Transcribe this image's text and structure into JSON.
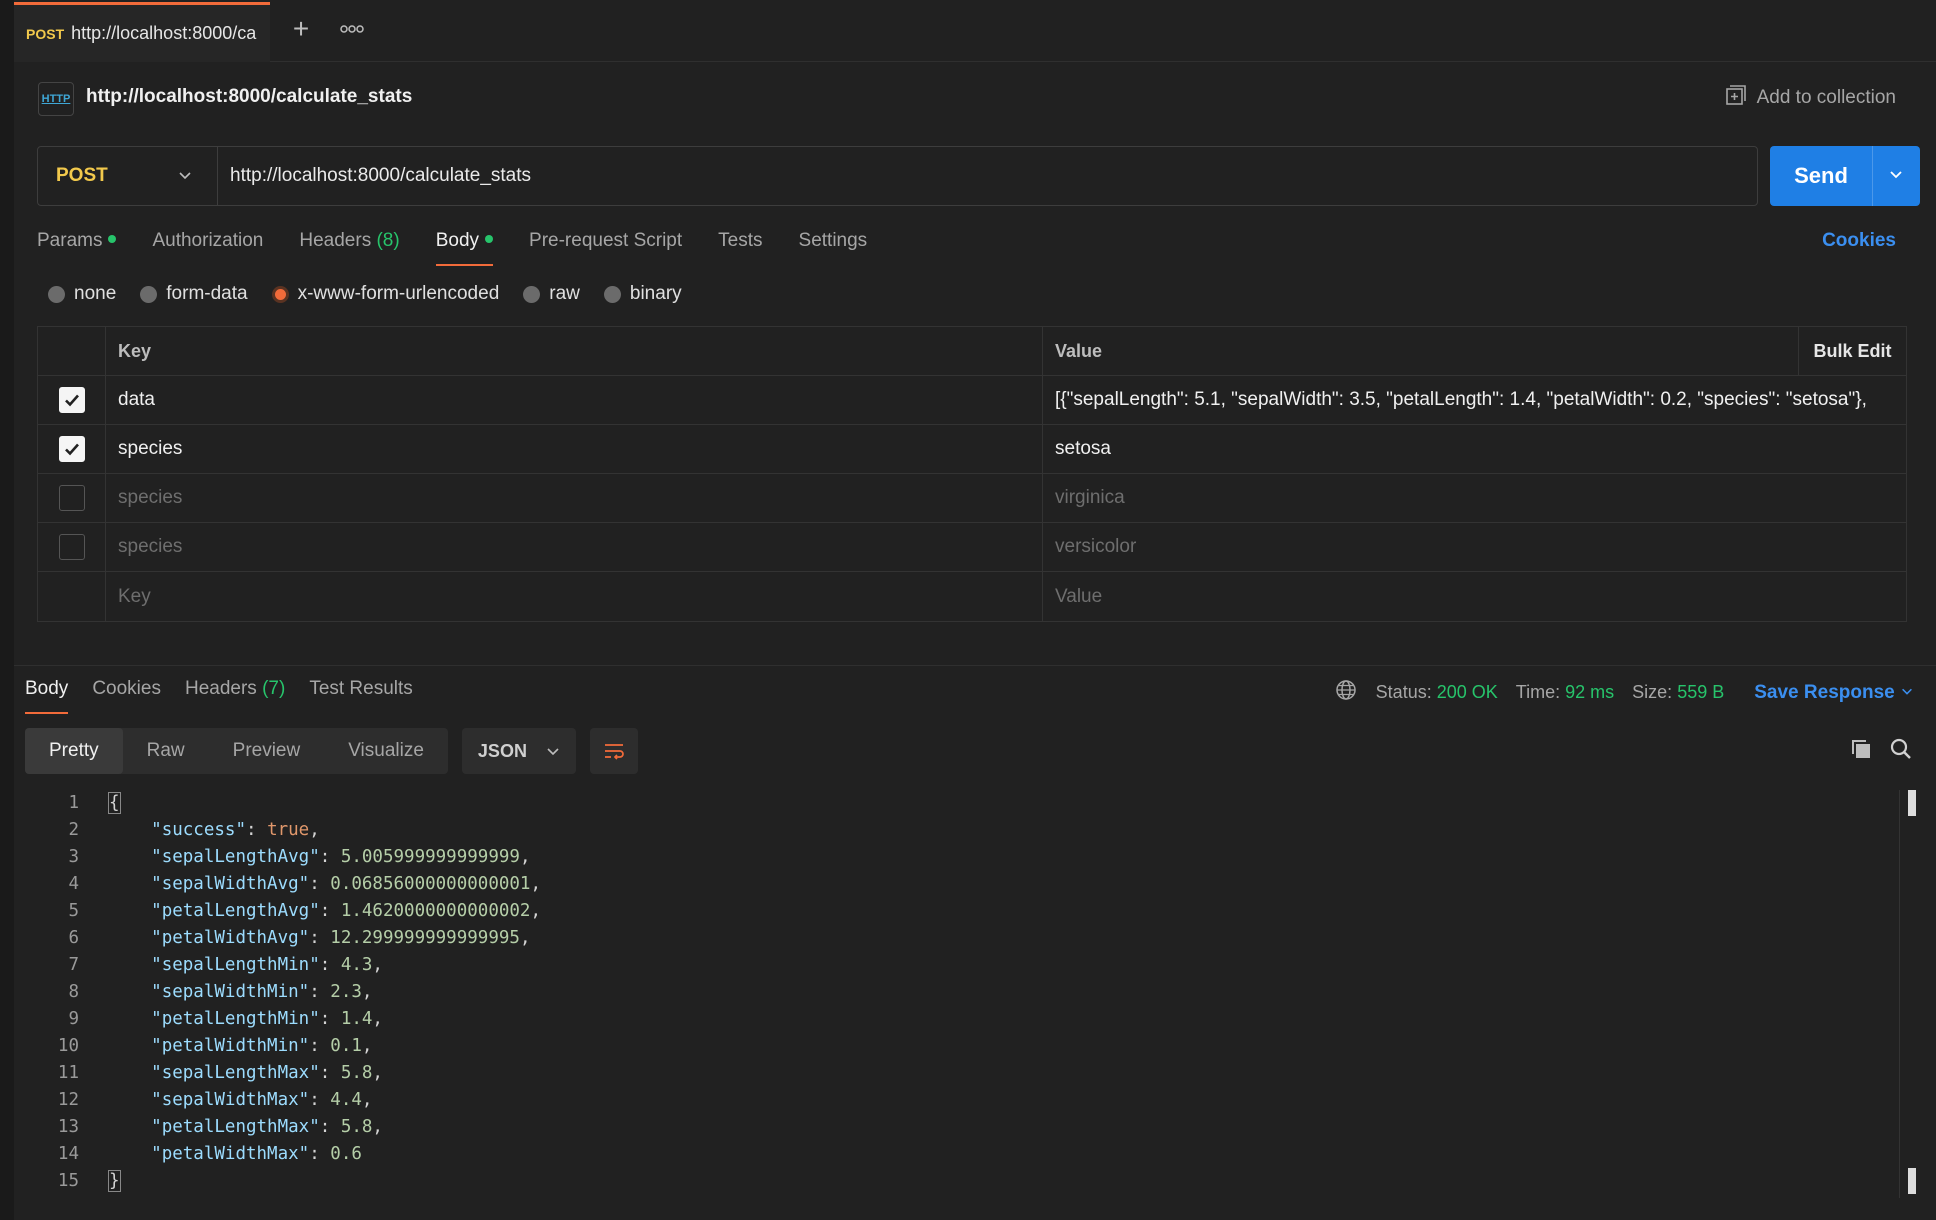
{
  "tab": {
    "method": "POST",
    "title": "http://localhost:8000/ca"
  },
  "request": {
    "name": "http://localhost:8000/calculate_stats",
    "add_to_collection": "Add to collection",
    "method": "POST",
    "url": "http://localhost:8000/calculate_stats",
    "send_label": "Send"
  },
  "req_tabs": [
    {
      "label": "Params",
      "dot": true
    },
    {
      "label": "Authorization"
    },
    {
      "label": "Headers",
      "count": "(8)"
    },
    {
      "label": "Body",
      "dot": true,
      "active": true
    },
    {
      "label": "Pre-request Script"
    },
    {
      "label": "Tests"
    },
    {
      "label": "Settings"
    }
  ],
  "cookies_label": "Cookies",
  "body_types": [
    "none",
    "form-data",
    "x-www-form-urlencoded",
    "raw",
    "binary"
  ],
  "body_type_selected": "x-www-form-urlencoded",
  "table": {
    "key_header": "Key",
    "value_header": "Value",
    "bulk_edit": "Bulk Edit",
    "rows": [
      {
        "checked": true,
        "key": "data",
        "value": "[{\"sepalLength\": 5.1, \"sepalWidth\": 3.5, \"petalLength\": 1.4, \"petalWidth\": 0.2, \"species\": \"setosa\"},"
      },
      {
        "checked": true,
        "key": "species",
        "value": "setosa"
      },
      {
        "checked": false,
        "key": "species",
        "value": "virginica"
      },
      {
        "checked": false,
        "key": "species",
        "value": "versicolor"
      }
    ],
    "key_placeholder": "Key",
    "value_placeholder": "Value"
  },
  "response": {
    "tabs": [
      {
        "label": "Body",
        "active": true
      },
      {
        "label": "Cookies"
      },
      {
        "label": "Headers",
        "count": "(7)"
      },
      {
        "label": "Test Results"
      }
    ],
    "status_label": "Status:",
    "status_value": "200 OK",
    "time_label": "Time:",
    "time_value": "92 ms",
    "size_label": "Size:",
    "size_value": "559 B",
    "save_response": "Save Response",
    "views": [
      "Pretty",
      "Raw",
      "Preview",
      "Visualize"
    ],
    "active_view": "Pretty",
    "format": "JSON",
    "json_lines": [
      {
        "n": "1",
        "open": "{"
      },
      {
        "n": "2",
        "key": "\"success\"",
        "val": "true",
        "type": "kw",
        "comma": true
      },
      {
        "n": "3",
        "key": "\"sepalLengthAvg\"",
        "val": "5.005999999999999",
        "comma": true
      },
      {
        "n": "4",
        "key": "\"sepalWidthAvg\"",
        "val": "0.06856000000000001",
        "comma": true
      },
      {
        "n": "5",
        "key": "\"petalLengthAvg\"",
        "val": "1.4620000000000002",
        "comma": true
      },
      {
        "n": "6",
        "key": "\"petalWidthAvg\"",
        "val": "12.299999999999995",
        "comma": true
      },
      {
        "n": "7",
        "key": "\"sepalLengthMin\"",
        "val": "4.3",
        "comma": true
      },
      {
        "n": "8",
        "key": "\"sepalWidthMin\"",
        "val": "2.3",
        "comma": true
      },
      {
        "n": "9",
        "key": "\"petalLengthMin\"",
        "val": "1.4",
        "comma": true
      },
      {
        "n": "10",
        "key": "\"petalWidthMin\"",
        "val": "0.1",
        "comma": true
      },
      {
        "n": "11",
        "key": "\"sepalLengthMax\"",
        "val": "5.8",
        "comma": true
      },
      {
        "n": "12",
        "key": "\"sepalWidthMax\"",
        "val": "4.4",
        "comma": true
      },
      {
        "n": "13",
        "key": "\"petalLengthMax\"",
        "val": "5.8",
        "comma": true
      },
      {
        "n": "14",
        "key": "\"petalWidthMax\"",
        "val": "0.6",
        "comma": false
      },
      {
        "n": "15",
        "close": "}"
      }
    ]
  },
  "colors": {
    "accent": "#f26b3a",
    "send": "#1f7fe5",
    "link": "#3b8ff0",
    "ok": "#27c46b",
    "method": "#f2c94c"
  }
}
